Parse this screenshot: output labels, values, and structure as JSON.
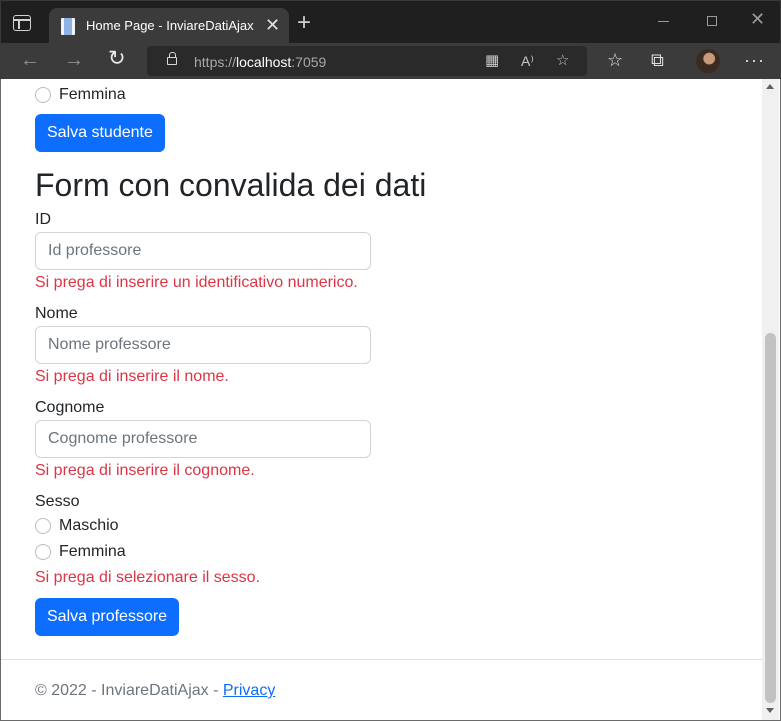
{
  "browser": {
    "tab_title": "Home Page - InviareDatiAjax",
    "url_scheme": "https://",
    "url_host": "localhost",
    "url_port": ":7059"
  },
  "student_form_tail": {
    "gender_female_label": "Femmina",
    "save_label": "Salva studente"
  },
  "professor_form": {
    "title": "Form con convalida dei dati",
    "id_label": "ID",
    "id_placeholder": "Id professore",
    "id_error": "Si prega di inserire un identificativo numerico.",
    "name_label": "Nome",
    "name_placeholder": "Nome professore",
    "name_error": "Si prega di inserire il nome.",
    "surname_label": "Cognome",
    "surname_placeholder": "Cognome professore",
    "surname_error": "Si prega di inserire il cognome.",
    "gender_label": "Sesso",
    "gender_male_label": "Maschio",
    "gender_female_label": "Femmina",
    "gender_error": "Si prega di selezionare il sesso.",
    "save_label": "Salva professore"
  },
  "footer": {
    "text": "© 2022 - InviareDatiAjax - ",
    "privacy_link": "Privacy"
  },
  "colors": {
    "primary": "#0d6efd",
    "error": "#dc3545"
  }
}
